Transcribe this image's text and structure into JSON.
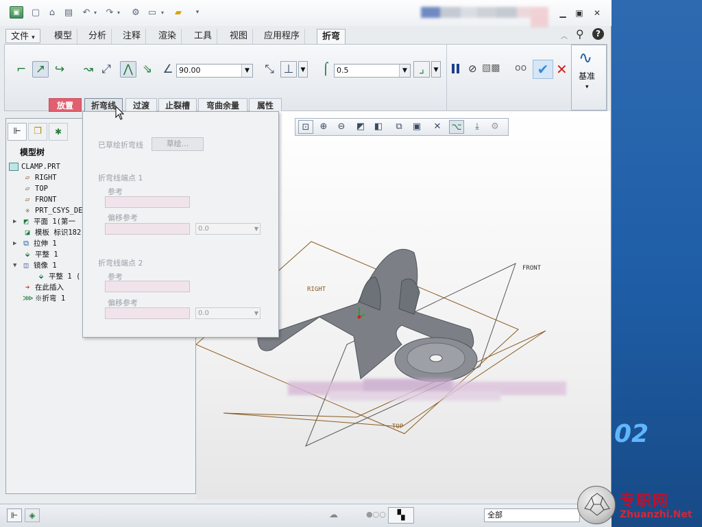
{
  "quick_access": {
    "icons": [
      "app-icon",
      "new-icon",
      "open-icon",
      "save-icon",
      "undo-icon",
      "redo-icon",
      "regenerate-icon",
      "windows-icon",
      "folder-icon",
      "more-icon"
    ]
  },
  "menu": {
    "file": "文件",
    "file_arrow": "▾",
    "tabs": [
      "模型",
      "分析",
      "注释",
      "渲染",
      "工具",
      "视图",
      "应用程序"
    ],
    "active_tab": "折弯"
  },
  "ribbon": {
    "angle_value": "90.00",
    "radius_value": "0.5",
    "datum_label": "基准",
    "datum_arrow": "▾",
    "subtabs": [
      "放置",
      "折弯线",
      "过渡",
      "止裂槽",
      "弯曲余量",
      "属性"
    ]
  },
  "sidepanel": {
    "title": "模型树",
    "tree": [
      {
        "label": "CLAMP.PRT",
        "icon": "part-icon"
      },
      {
        "label": "RIGHT",
        "icon": "datum-plane-icon"
      },
      {
        "label": "TOP",
        "icon": "datum-plane-icon"
      },
      {
        "label": "FRONT",
        "icon": "datum-plane-icon"
      },
      {
        "label": "PRT_CSYS_DEF",
        "icon": "csys-icon"
      },
      {
        "label": "平面 1(第一",
        "icon": "flat-wall-icon",
        "expand": "▶"
      },
      {
        "label": "模板 标识182",
        "icon": "template-icon"
      },
      {
        "label": "拉伸 1",
        "icon": "extrude-icon",
        "expand": "▶"
      },
      {
        "label": "平整 1",
        "icon": "flat-icon"
      },
      {
        "label": "镜像 1",
        "icon": "mirror-icon",
        "expand": "▼"
      },
      {
        "label": "平整 1 (",
        "icon": "flat-icon"
      },
      {
        "label": "在此插入",
        "icon": "insert-here-icon"
      },
      {
        "label": "※折弯 1",
        "icon": "bend-icon"
      }
    ]
  },
  "dropdown": {
    "sketched_label": "已草绘折弯线",
    "sketch_button": "草绘...",
    "endpoint1": "折弯线端点 1",
    "endpoint2": "折弯线端点 2",
    "reference": "参考",
    "offset_reference": "偏移参考",
    "offset_value": "0.0"
  },
  "graphics": {
    "datum_labels": {
      "right": "RIGHT",
      "front": "FRONT",
      "top": "TOP"
    }
  },
  "statusbar": {
    "filter_value": "全部"
  },
  "watermark": {
    "site_cn": "专职网",
    "site_en": "Zhuanzhi.Net",
    "number": "02"
  },
  "colors": {
    "subtab_active": "#e06070",
    "accept": "#3a8ad6",
    "cancel": "#d02020",
    "pause": "#1c3f8a",
    "model": "#7c8086"
  }
}
